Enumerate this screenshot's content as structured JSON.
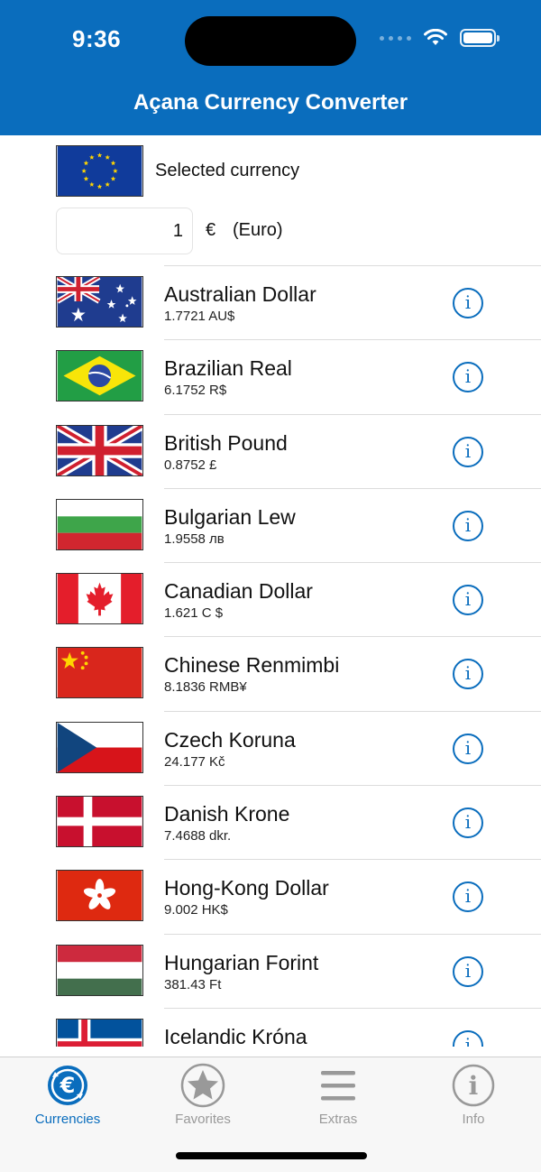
{
  "status_bar": {
    "time": "9:36"
  },
  "header": {
    "title": "Açana Currency Converter"
  },
  "selected": {
    "label": "Selected currency",
    "amount": "1",
    "symbol": "€",
    "name": "(Euro)"
  },
  "currencies": [
    {
      "name": "Australian Dollar",
      "rate": "1.7721 AU$",
      "flag": "australia-flag-icon"
    },
    {
      "name": "Brazilian Real",
      "rate": "6.1752 R$",
      "flag": "brazil-flag-icon"
    },
    {
      "name": "British Pound",
      "rate": "0.8752 £",
      "flag": "uk-flag-icon"
    },
    {
      "name": "Bulgarian Lew",
      "rate": "1.9558 лв",
      "flag": "bulgaria-flag-icon"
    },
    {
      "name": "Canadian Dollar",
      "rate": "1.621 C $",
      "flag": "canada-flag-icon"
    },
    {
      "name": "Chinese Renmimbi",
      "rate": "8.1836 RMB¥",
      "flag": "china-flag-icon"
    },
    {
      "name": "Czech Koruna",
      "rate": "24.177 Kč",
      "flag": "czech-flag-icon"
    },
    {
      "name": "Danish Krone",
      "rate": "7.4688 dkr.",
      "flag": "denmark-flag-icon"
    },
    {
      "name": "Hong-Kong Dollar",
      "rate": "9.002 HK$",
      "flag": "hongkong-flag-icon"
    },
    {
      "name": "Hungarian Forint",
      "rate": "381.43 Ft",
      "flag": "hungary-flag-icon"
    },
    {
      "name": "Icelandic Króna",
      "rate": "",
      "flag": "iceland-flag-icon"
    }
  ],
  "tabs": [
    {
      "label": "Currencies",
      "icon": "currencies-icon",
      "active": true
    },
    {
      "label": "Favorites",
      "icon": "star-icon",
      "active": false
    },
    {
      "label": "Extras",
      "icon": "menu-lines-icon",
      "active": false
    },
    {
      "label": "Info",
      "icon": "info-icon",
      "active": false
    }
  ],
  "colors": {
    "accent": "#0a6dbd",
    "header_bg": "#0a6dbd"
  }
}
